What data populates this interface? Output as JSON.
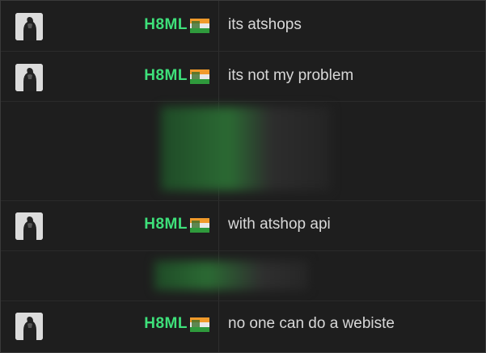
{
  "messages": [
    {
      "username": "H8ML",
      "text": "its atshops"
    },
    {
      "username": "H8ML",
      "text": "its not my problem"
    },
    {
      "username": "H8ML",
      "text": "with atshop api"
    },
    {
      "username": "H8ML",
      "text": "no one can do a webiste"
    }
  ],
  "colors": {
    "background": "#1e1e1e",
    "username": "#3ee07a",
    "message_text": "#d8d8d8",
    "divider": "#2b2b2b"
  },
  "icons": {
    "avatar": "hooded-figure-avatar-icon",
    "flag": "flag-badge-icon"
  }
}
